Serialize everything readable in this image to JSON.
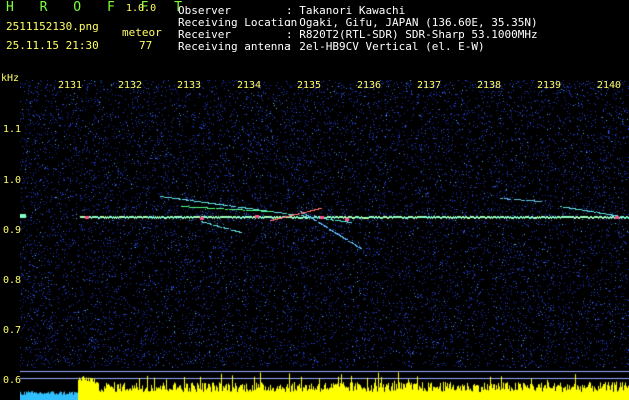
{
  "app": {
    "name": "H R O F F T",
    "version": "1.0.0"
  },
  "file": {
    "name": "2511152130.png",
    "datetime": "25.11.15 21:30"
  },
  "meteor": {
    "label": "meteor",
    "count": "77"
  },
  "station": [
    {
      "key": "Observer",
      "value": ": Takanori Kawachi"
    },
    {
      "key": "Receiving Location",
      "value": ": Ogaki, Gifu, JAPAN (136.60E, 35.35N)"
    },
    {
      "key": "Receiver",
      "value": ": R820T2(RTL-SDR) SDR-Sharp 53.1000MHz"
    },
    {
      "key": "Receiving antenna",
      "value": ": 2el-HB9CV Vertical (el. E-W)"
    }
  ],
  "axis": {
    "y_unit": "kHz",
    "y_ticks": [
      "1.1",
      "1.0",
      "0.9",
      "0.8",
      "0.7",
      "0.6"
    ],
    "x_ticks": [
      "2131",
      "2132",
      "2133",
      "2134",
      "2135",
      "2136",
      "2137",
      "2138",
      "2139",
      "2140"
    ]
  },
  "colors": {
    "text_green": "#7cff3a",
    "text_yellow": "#ffff66",
    "background": "#000000",
    "spectrogram_noise": "#1a2aa0",
    "signal": "#7cffd0",
    "level_bars": "#ffff00"
  }
}
